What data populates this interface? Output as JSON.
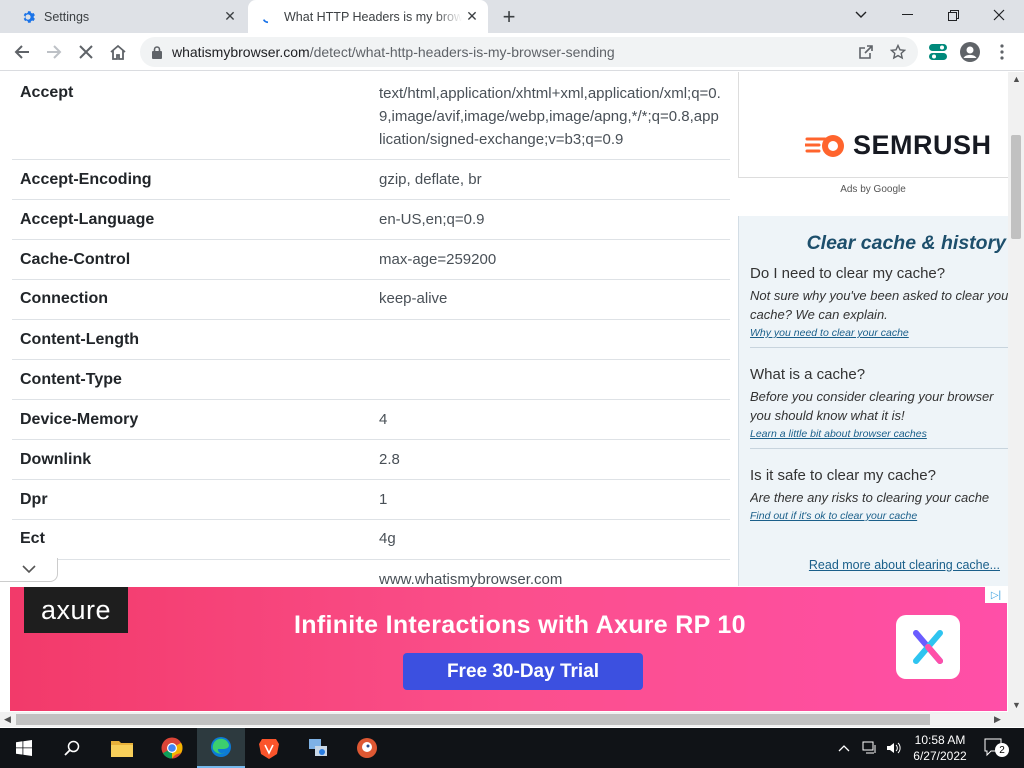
{
  "browser": {
    "tabs": [
      {
        "title": "Settings",
        "icon": "gear-icon"
      },
      {
        "title": "What HTTP Headers is my browser sending",
        "icon": "loading-icon"
      }
    ],
    "url": {
      "domain": "whatismybrowser.com",
      "path": "/detect/what-http-headers-is-my-browser-sending"
    }
  },
  "headers": [
    {
      "name": "Accept",
      "value": "text/html,application/xhtml+xml,application/xml;q=0.9,image/avif,image/webp,image/apng,*/*;q=0.8,application/signed-exchange;v=b3;q=0.9"
    },
    {
      "name": "Accept-Encoding",
      "value": "gzip, deflate, br"
    },
    {
      "name": "Accept-Language",
      "value": "en-US,en;q=0.9"
    },
    {
      "name": "Cache-Control",
      "value": "max-age=259200"
    },
    {
      "name": "Connection",
      "value": "keep-alive"
    },
    {
      "name": "Content-Length",
      "value": ""
    },
    {
      "name": "Content-Type",
      "value": ""
    },
    {
      "name": "Device-Memory",
      "value": "4"
    },
    {
      "name": "Downlink",
      "value": "2.8"
    },
    {
      "name": "Dpr",
      "value": "1"
    },
    {
      "name": "Ect",
      "value": "4g"
    },
    {
      "name": "",
      "value": "www.whatismybrowser.com"
    }
  ],
  "sidebar": {
    "ad_brand": "SEMRUSH",
    "ads_by": "Ads by Google",
    "cache_title": "Clear cache & history",
    "items": [
      {
        "question": "Do I need to clear my cache?",
        "line1": "Not sure why you've been asked to clear your",
        "line2": "cache? We can explain.",
        "link": "Why you need to clear your cache"
      },
      {
        "question": "What is a cache?",
        "line1": "Before you consider clearing your browser",
        "line2": "you should know what it is!",
        "link": "Learn a little bit about browser caches"
      },
      {
        "question": "Is it safe to clear my cache?",
        "line1": "Are there any risks to clearing your cache",
        "line2": "",
        "link": "Find out if it's ok to clear your cache"
      }
    ],
    "read_more": "Read more about clearing cache..."
  },
  "banner": {
    "logo": "axure",
    "headline": "Infinite Interactions with Axure RP 10",
    "cta": "Free 30-Day Trial",
    "colors": {
      "bg_left": "#f23a6a",
      "bg_right": "#ff4fa8",
      "cta": "#3c50e0"
    }
  },
  "taskbar": {
    "time": "10:58 AM",
    "date": "6/27/2022",
    "notifications": "2"
  }
}
